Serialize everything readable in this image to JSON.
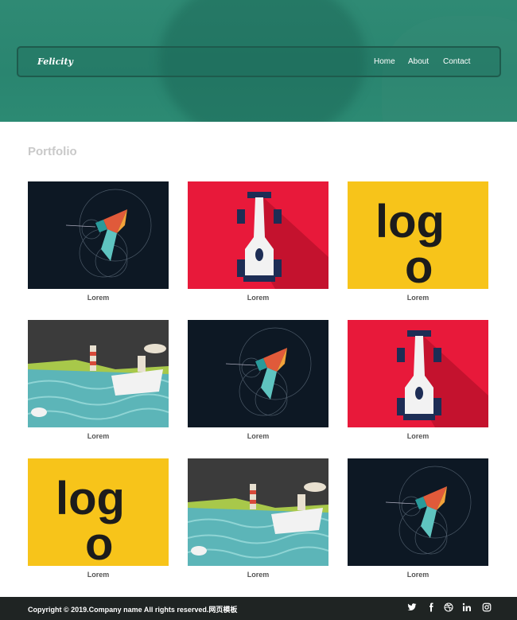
{
  "brand": "Felicity",
  "nav": {
    "home": "Home",
    "about": "About",
    "contact": "Contact"
  },
  "section_title": "Portfolio",
  "items": [
    {
      "caption": "Lorem",
      "art": "hummingbird"
    },
    {
      "caption": "Lorem",
      "art": "racecar"
    },
    {
      "caption": "Lorem",
      "art": "logo"
    },
    {
      "caption": "Lorem",
      "art": "seascape"
    },
    {
      "caption": "Lorem",
      "art": "hummingbird"
    },
    {
      "caption": "Lorem",
      "art": "racecar"
    },
    {
      "caption": "Lorem",
      "art": "logo"
    },
    {
      "caption": "Lorem",
      "art": "seascape"
    },
    {
      "caption": "Lorem",
      "art": "hummingbird"
    }
  ],
  "logo_text": {
    "top": "log",
    "bottom": "o"
  },
  "footer": {
    "copyright": "Copyright © 2019.Company name All rights reserved.网页模板"
  },
  "social": [
    "twitter-icon",
    "facebook-icon",
    "dribbble-icon",
    "linkedin-icon",
    "instagram-icon"
  ],
  "colors": {
    "hero": "#2a8570",
    "footer": "#1f2423",
    "dark_art": "#0d1824",
    "red_art": "#e8193a",
    "yellow_art": "#f7c41a"
  }
}
